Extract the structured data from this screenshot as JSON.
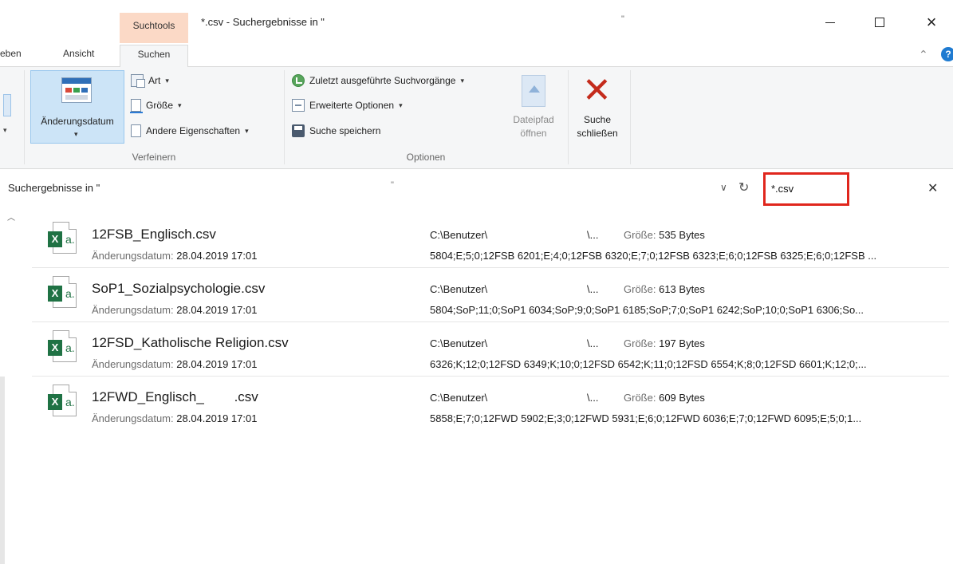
{
  "titlebar": {
    "contextual_tab_label": "Suchtools",
    "window_title": "*.csv - Suchergebnisse in \"",
    "title_quote": "\""
  },
  "ribbon_tabs": {
    "share": "eben",
    "view": "Ansicht",
    "search": "Suchen"
  },
  "ribbon": {
    "refine": {
      "group_label": "Verfeinern",
      "date_modified": "Änderungsdatum",
      "type": "Art",
      "size": "Größe",
      "other_properties": "Andere Eigenschaften"
    },
    "options": {
      "group_label": "Optionen",
      "recent_searches": "Zuletzt ausgeführte Suchvorgänge",
      "advanced_options": "Erweiterte Optionen",
      "save_search": "Suche speichern",
      "open_path_line1": "Dateipfad",
      "open_path_line2": "öffnen"
    },
    "close_search_line1": "Suche",
    "close_search_line2": "schließen"
  },
  "address": {
    "path": "Suchergebnisse in \"",
    "quote": "\""
  },
  "search": {
    "value": "*.csv"
  },
  "labels": {
    "date_modified": "Änderungsdatum:",
    "size": "Größe:"
  },
  "results": [
    {
      "name": "12FSB_Englisch.csv",
      "date": "28.04.2019 17:01",
      "path": "C:\\Benutzer\\",
      "ellipsis": "\\...",
      "size": "535 Bytes",
      "content": "5804;E;5;0;12FSB 6201;E;4;0;12FSB 6320;E;7;0;12FSB 6323;E;6;0;12FSB 6325;E;6;0;12FSB ..."
    },
    {
      "name": "SoP1_Sozialpsychologie.csv",
      "date": "28.04.2019 17:01",
      "path": "C:\\Benutzer\\",
      "ellipsis": "\\...",
      "size": "613 Bytes",
      "content": "5804;SoP;11;0;SoP1 6034;SoP;9;0;SoP1 6185;SoP;7;0;SoP1 6242;SoP;10;0;SoP1 6306;So..."
    },
    {
      "name": "12FSD_Katholische Religion.csv",
      "date": "28.04.2019 17:01",
      "path": "C:\\Benutzer\\",
      "ellipsis": "\\...",
      "size": "197 Bytes",
      "content": "6326;K;12;0;12FSD 6349;K;10;0;12FSD 6542;K;11;0;12FSD 6554;K;8;0;12FSD 6601;K;12;0;..."
    },
    {
      "name": "12FWD_Englisch_        .csv",
      "date": "28.04.2019 17:01",
      "path": "C:\\Benutzer\\",
      "ellipsis": "\\...",
      "size": "609 Bytes",
      "content": "5858;E;7;0;12FWD 5902;E;3;0;12FWD 5931;E;6;0;12FWD 6036;E;7;0;12FWD 6095;E;5;0;1..."
    }
  ],
  "colors": {
    "contextual_tab": "#fbd9c6",
    "selected_button": "#cce4f7",
    "search_highlight": "#e0261d",
    "close_x": "#c42b1c",
    "excel_green": "#1f7244"
  }
}
